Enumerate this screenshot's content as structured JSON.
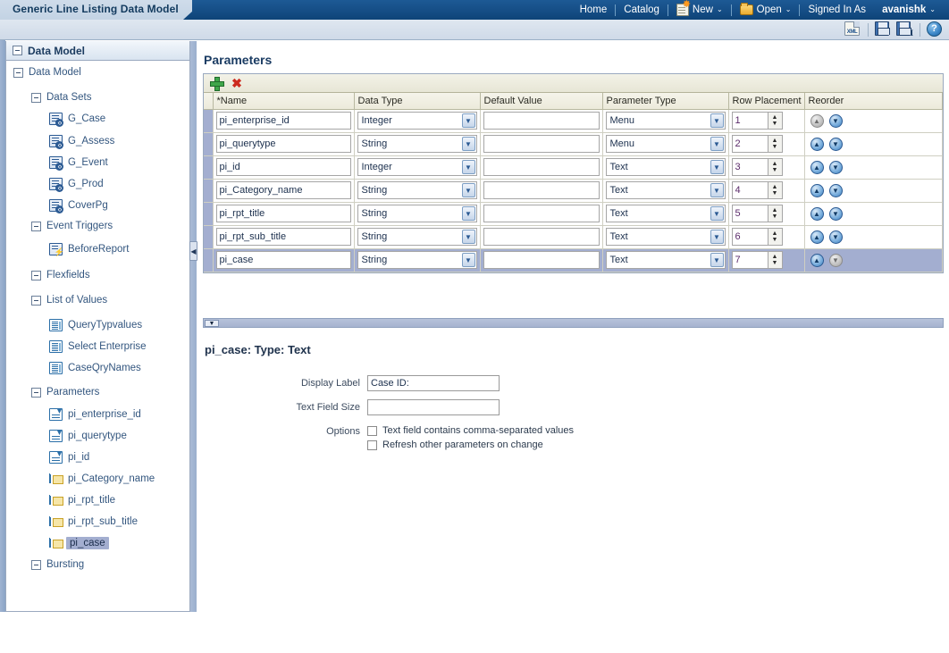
{
  "window": {
    "tab_title": "Generic Line Listing Data Model"
  },
  "global_nav": {
    "home": "Home",
    "catalog": "Catalog",
    "new": "New",
    "open": "Open",
    "signed_in_as_label": "Signed In As",
    "user": "avanishk",
    "caret": "⌄"
  },
  "toolbar": {
    "xml_icon": "xml-view-icon",
    "save_icon": "save-icon",
    "save_as_icon": "save-as-icon",
    "help_icon": "help-icon",
    "help_glyph": "?",
    "save_as_glyph": "I"
  },
  "sidebar": {
    "header_title": "Data Model",
    "tree": [
      {
        "label": "Data Model",
        "indent": 0,
        "toggle": true,
        "icon": null,
        "selected": false
      },
      {
        "label": "Data Sets",
        "indent": 1,
        "toggle": true,
        "icon": null,
        "selected": false
      },
      {
        "label": "G_Case",
        "indent": 2,
        "toggle": false,
        "icon": "dataset-icon",
        "selected": false
      },
      {
        "label": "G_Assess",
        "indent": 2,
        "toggle": false,
        "icon": "dataset-icon",
        "selected": false
      },
      {
        "label": "G_Event",
        "indent": 2,
        "toggle": false,
        "icon": "dataset-icon",
        "selected": false
      },
      {
        "label": "G_Prod",
        "indent": 2,
        "toggle": false,
        "icon": "dataset-icon",
        "selected": false
      },
      {
        "label": "CoverPg",
        "indent": 2,
        "toggle": false,
        "icon": "dataset-icon",
        "selected": false
      },
      {
        "label": "Event Triggers",
        "indent": 1,
        "toggle": true,
        "icon": null,
        "selected": false
      },
      {
        "label": "BeforeReport",
        "indent": 2,
        "toggle": false,
        "icon": "trigger-icon",
        "selected": false
      },
      {
        "label": "Flexfields",
        "indent": 1,
        "toggle": true,
        "icon": null,
        "selected": false
      },
      {
        "label": "List of Values",
        "indent": 1,
        "toggle": true,
        "icon": null,
        "selected": false
      },
      {
        "label": "QueryTypvalues",
        "indent": 2,
        "toggle": false,
        "icon": "lov-icon",
        "selected": false
      },
      {
        "label": "Select Enterprise",
        "indent": 2,
        "toggle": false,
        "icon": "lov-icon",
        "selected": false
      },
      {
        "label": "CaseQryNames",
        "indent": 2,
        "toggle": false,
        "icon": "lov-icon",
        "selected": false
      },
      {
        "label": "Parameters",
        "indent": 1,
        "toggle": true,
        "icon": null,
        "selected": false
      },
      {
        "label": "pi_enterprise_id",
        "indent": 2,
        "toggle": false,
        "icon": "menu-param-icon",
        "selected": false
      },
      {
        "label": "pi_querytype",
        "indent": 2,
        "toggle": false,
        "icon": "menu-param-icon",
        "selected": false
      },
      {
        "label": "pi_id",
        "indent": 2,
        "toggle": false,
        "icon": "menu-param-icon",
        "selected": false
      },
      {
        "label": "pi_Category_name",
        "indent": 2,
        "toggle": false,
        "icon": "text-param-icon",
        "selected": false
      },
      {
        "label": "pi_rpt_title",
        "indent": 2,
        "toggle": false,
        "icon": "text-param-icon",
        "selected": false
      },
      {
        "label": "pi_rpt_sub_title",
        "indent": 2,
        "toggle": false,
        "icon": "text-param-icon",
        "selected": false
      },
      {
        "label": "pi_case",
        "indent": 2,
        "toggle": false,
        "icon": "text-param-icon",
        "selected": true
      },
      {
        "label": "Bursting",
        "indent": 1,
        "toggle": true,
        "icon": null,
        "selected": false
      }
    ],
    "collapse_handle": "◀"
  },
  "parameters_panel": {
    "title": "Parameters",
    "add_label": "+",
    "delete_label": "✖",
    "columns": [
      "*Name",
      "Data Type",
      "Default Value",
      "Parameter Type",
      "Row Placement",
      "Reorder"
    ],
    "rows": [
      {
        "name": "pi_enterprise_id",
        "data_type": "Integer",
        "default_value": "",
        "parameter_type": "Menu",
        "row_placement": "1",
        "up_enabled": false,
        "down_enabled": true,
        "selected": false
      },
      {
        "name": "pi_querytype",
        "data_type": "String",
        "default_value": "",
        "parameter_type": "Menu",
        "row_placement": "2",
        "up_enabled": true,
        "down_enabled": true,
        "selected": false
      },
      {
        "name": "pi_id",
        "data_type": "Integer",
        "default_value": "",
        "parameter_type": "Text",
        "row_placement": "3",
        "up_enabled": true,
        "down_enabled": true,
        "selected": false
      },
      {
        "name": "pi_Category_name",
        "data_type": "String",
        "default_value": "",
        "parameter_type": "Text",
        "row_placement": "4",
        "up_enabled": true,
        "down_enabled": true,
        "selected": false
      },
      {
        "name": "pi_rpt_title",
        "data_type": "String",
        "default_value": "",
        "parameter_type": "Text",
        "row_placement": "5",
        "up_enabled": true,
        "down_enabled": true,
        "selected": false
      },
      {
        "name": "pi_rpt_sub_title",
        "data_type": "String",
        "default_value": "",
        "parameter_type": "Text",
        "row_placement": "6",
        "up_enabled": true,
        "down_enabled": true,
        "selected": false
      },
      {
        "name": "pi_case",
        "data_type": "String",
        "default_value": "",
        "parameter_type": "Text",
        "row_placement": "7",
        "up_enabled": true,
        "down_enabled": false,
        "selected": true
      }
    ],
    "spin_up": "▲",
    "spin_down": "▼",
    "reorder_up": "▲",
    "reorder_down": "▼",
    "select_arrow": "▼"
  },
  "detail_panel": {
    "collapse_glyph": "▼",
    "title": "pi_case: Type: Text",
    "display_label_label": "Display Label",
    "display_label_value": "Case ID:",
    "text_field_size_label": "Text Field Size",
    "text_field_size_value": "",
    "options_label": "Options",
    "option_csv": "Text field contains comma-separated values",
    "option_refresh": "Refresh other parameters on change"
  },
  "colors": {
    "header_blue": "#164f87",
    "tab_bg": "#c9d8e8",
    "selection": "#a3aed0",
    "tree_text": "#33567f",
    "grid_header": "#eceadb"
  }
}
